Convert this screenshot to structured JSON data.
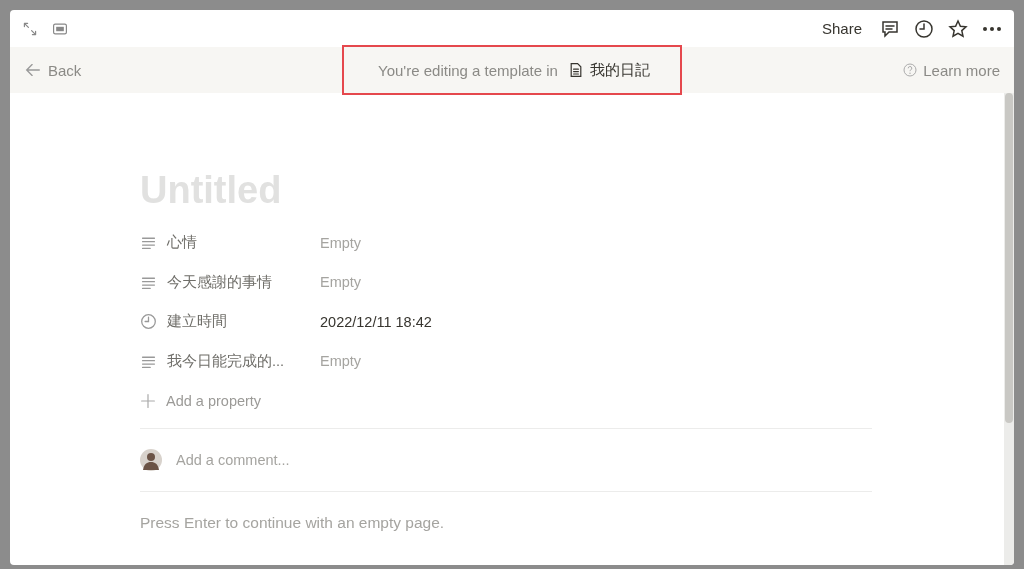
{
  "topbar": {
    "share": "Share"
  },
  "banner": {
    "back": "Back",
    "message": "You're editing a template in",
    "database": "我的日記",
    "learn_more": "Learn more"
  },
  "page": {
    "title_placeholder": "Untitled",
    "properties": [
      {
        "kind": "text",
        "name": "心情",
        "value": "Empty",
        "empty": true
      },
      {
        "kind": "text",
        "name": "今天感謝的事情",
        "value": "Empty",
        "empty": true
      },
      {
        "kind": "time",
        "name": "建立時間",
        "value": "2022/12/11 18:42",
        "empty": false
      },
      {
        "kind": "text",
        "name": "我今日能完成的...",
        "value": "Empty",
        "empty": true
      }
    ],
    "add_property": "Add a property",
    "comment_placeholder": "Add a comment...",
    "hint": "Press Enter to continue with an empty page."
  }
}
